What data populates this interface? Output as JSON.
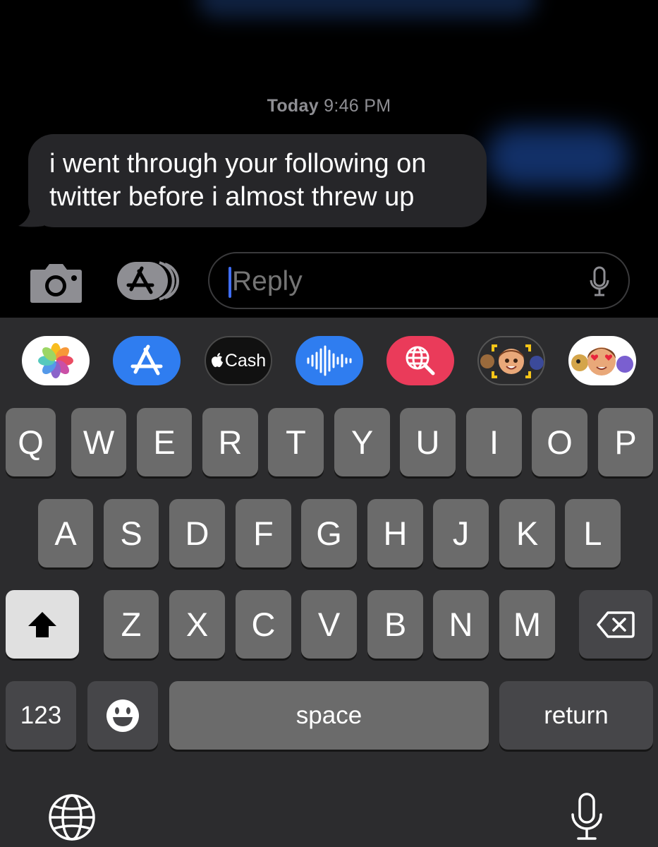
{
  "conversation": {
    "timestamp_day": "Today",
    "timestamp_time": "9:46 PM",
    "message_line1": "i went through your following on",
    "message_line2": "twitter before i almost threw up"
  },
  "composer": {
    "placeholder": "Reply",
    "camera_icon": "camera-icon",
    "apps_icon": "app-store-icon",
    "mic_icon": "microphone-icon"
  },
  "app_drawer": {
    "items": [
      {
        "name": "photos-app",
        "icon": "photos-icon"
      },
      {
        "name": "app-store-app",
        "icon": "app-store-icon"
      },
      {
        "name": "apple-cash-app",
        "label": "Cash",
        "icon": "apple-logo-icon"
      },
      {
        "name": "audio-message-app",
        "icon": "waveform-icon"
      },
      {
        "name": "gif-search-app",
        "icon": "globe-search-icon"
      },
      {
        "name": "memoji-app",
        "icon": "memoji-icon"
      },
      {
        "name": "memoji-stickers-app",
        "icon": "memoji-stickers-icon"
      }
    ]
  },
  "keyboard": {
    "row1": [
      "Q",
      "W",
      "E",
      "R",
      "T",
      "Y",
      "U",
      "I",
      "O",
      "P"
    ],
    "row2": [
      "A",
      "S",
      "D",
      "F",
      "G",
      "H",
      "J",
      "K",
      "L"
    ],
    "row3": [
      "Z",
      "X",
      "C",
      "V",
      "B",
      "N",
      "M"
    ],
    "numbers_label": "123",
    "space_label": "space",
    "return_label": "return",
    "emoji_icon": "emoji-icon",
    "globe_icon": "globe-icon",
    "dictation_icon": "microphone-icon"
  },
  "colors": {
    "background": "#000000",
    "bubble": "#262629",
    "keyboard": "#2c2c2e",
    "key": "#6b6b6b",
    "cursor": "#3f6df2"
  }
}
